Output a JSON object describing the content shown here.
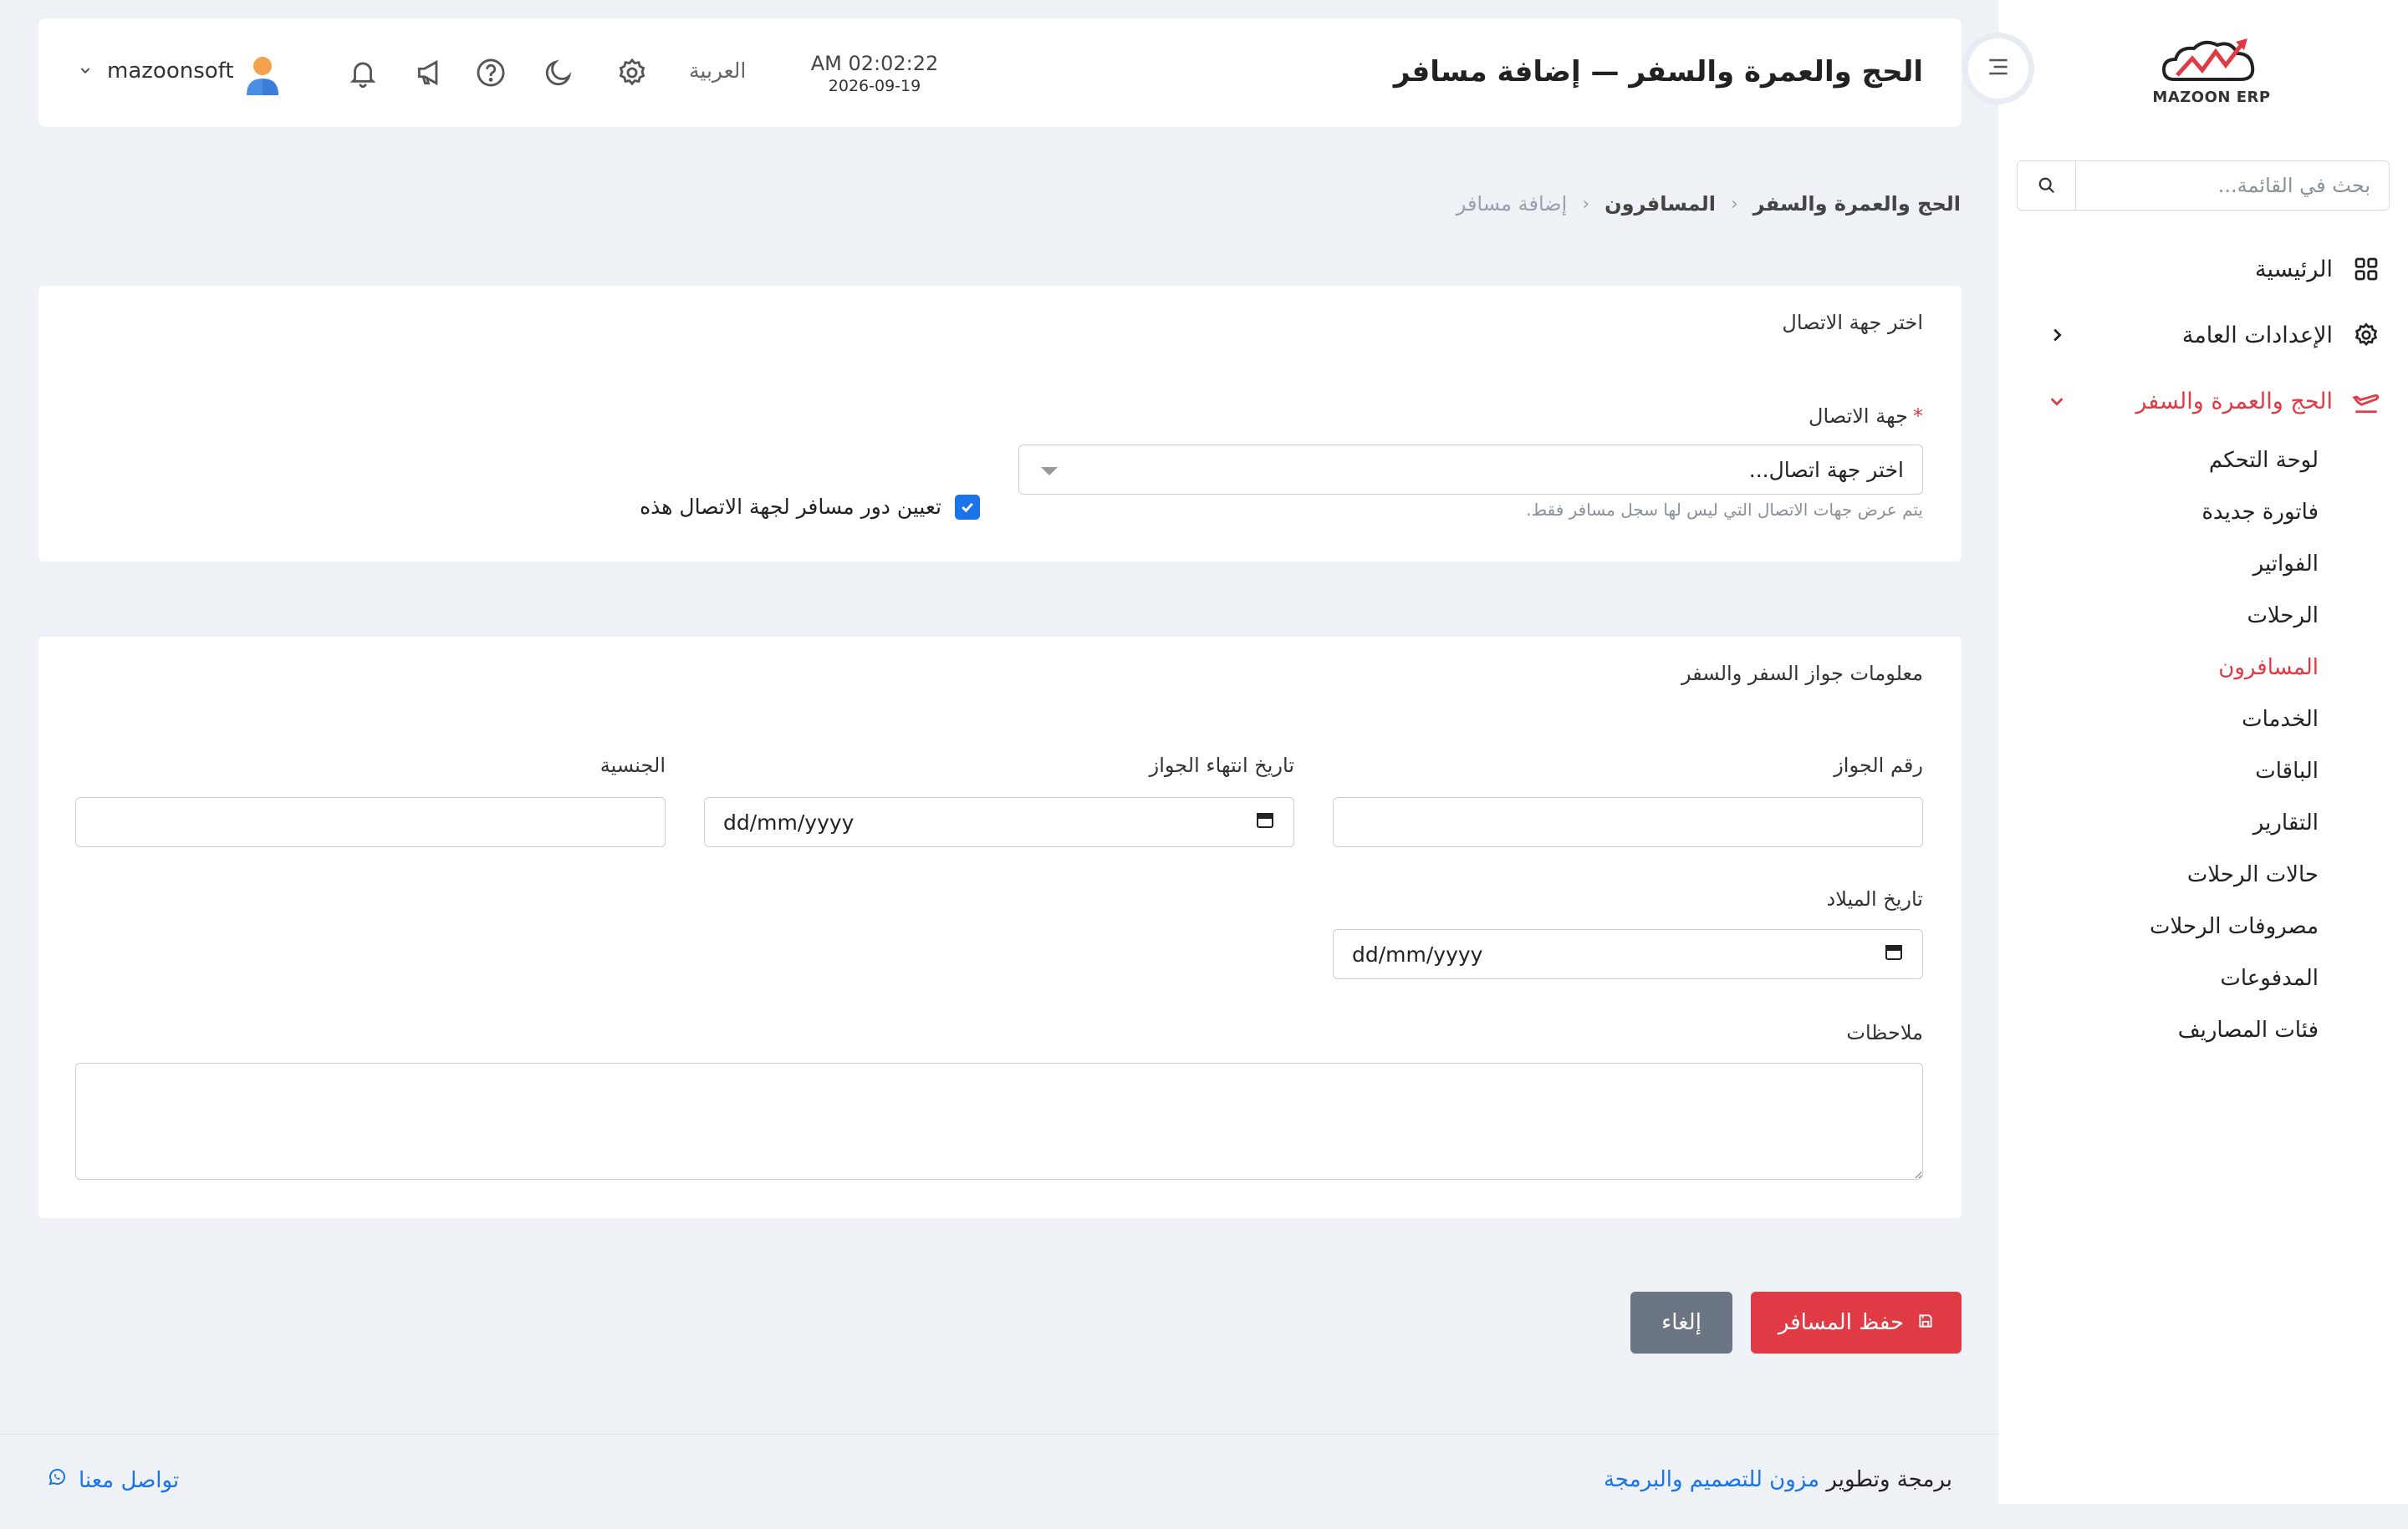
{
  "app": {
    "logo_text": "MAZOON ERP",
    "brand_color": "#e03a45",
    "accent_color": "#1a73e8"
  },
  "sidebar": {
    "search_placeholder": "بحث في القائمة...",
    "items": [
      {
        "label": "الرئيسية",
        "icon": "grid-icon"
      },
      {
        "label": "الإعدادات العامة",
        "icon": "gear-icon"
      },
      {
        "label": "الحج والعمرة والسفر",
        "icon": "plane-icon",
        "active": true
      }
    ],
    "sub_items": [
      "لوحة التحكم",
      "فاتورة جديدة",
      "الفواتير",
      "الرحلات",
      "المسافرون",
      "الخدمات",
      "الباقات",
      "التقارير",
      "حالات الرحلات",
      "مصروفات الرحلات",
      "المدفوعات",
      "فئات المصاريف"
    ],
    "active_sub": "المسافرون"
  },
  "header": {
    "title": "الحج والعمرة والسفر — إضافة مسافر",
    "time": "AM 02:02:22",
    "date": "2026-09-19",
    "language": "العربية",
    "username": "mazoonsoft"
  },
  "breadcrumb": {
    "items": [
      "الحج والعمرة والسفر",
      "المسافرون",
      "إضافة مسافر"
    ]
  },
  "contact_card": {
    "title": "اختر جهة الاتصال",
    "field_label": "جهة الاتصال",
    "required_mark": "*",
    "select_value": "اختر جهة اتصال...",
    "hint": "يتم عرض جهات الاتصال التي ليس لها سجل مسافر فقط.",
    "checkbox_label": "تعيين دور مسافر لجهة الاتصال هذه",
    "checkbox_checked": true
  },
  "passport_card": {
    "title": "معلومات جواز السفر والسفر",
    "passport_number_label": "رقم الجواز",
    "passport_number_value": "",
    "passport_expiry_label": "تاريخ انتهاء الجواز",
    "passport_expiry_placeholder": "dd/mm/yyyy",
    "nationality_label": "الجنسية",
    "nationality_value": "",
    "birth_date_label": "تاريخ الميلاد",
    "birth_date_placeholder": "dd/mm/yyyy",
    "notes_label": "ملاحظات",
    "notes_value": ""
  },
  "actions": {
    "save_label": "حفظ المسافر",
    "cancel_label": "إلغاء"
  },
  "footer": {
    "credit_prefix": "برمجة وتطوير",
    "credit_brand": "مزون للتصميم والبرمجة",
    "contact_label": "تواصل معنا"
  }
}
